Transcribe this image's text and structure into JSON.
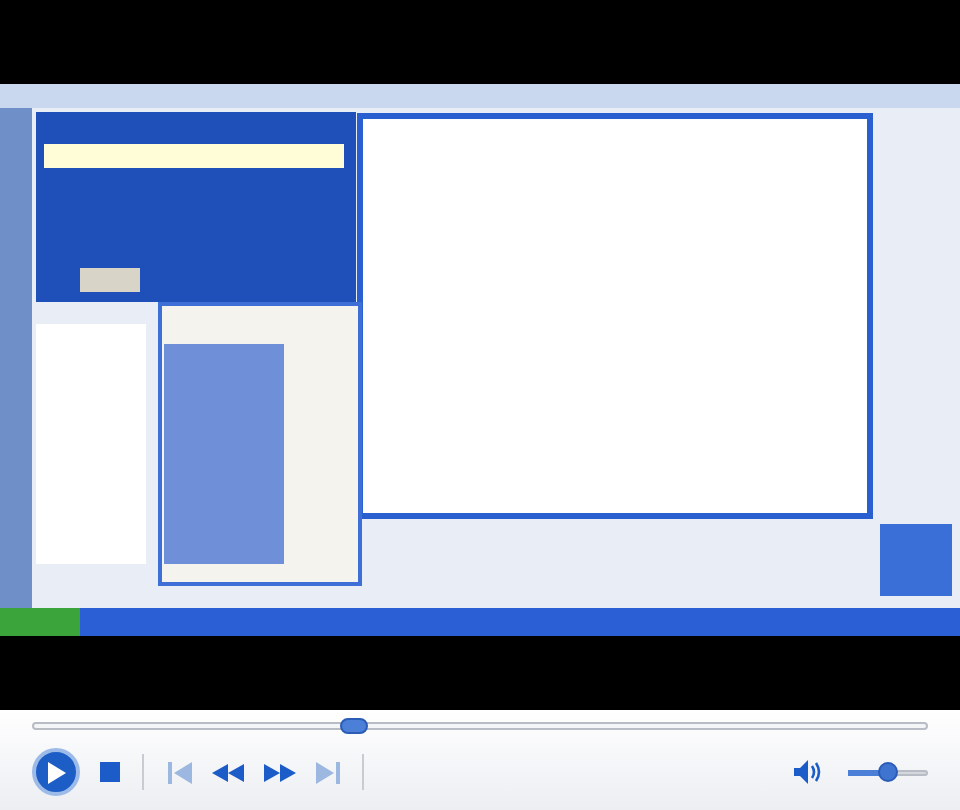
{
  "seek": {
    "level": 0.36
  },
  "play": {
    "playing": false
  },
  "controls": [
    {
      "kind": "stop",
      "disabled": false
    },
    {
      "kind": "previous",
      "disabled": true
    },
    {
      "kind": "rewind",
      "disabled": false
    },
    {
      "kind": "fast_forward",
      "disabled": false
    },
    {
      "kind": "next",
      "disabled": true
    }
  ],
  "volume": {
    "level": 0.5,
    "muted": false
  }
}
